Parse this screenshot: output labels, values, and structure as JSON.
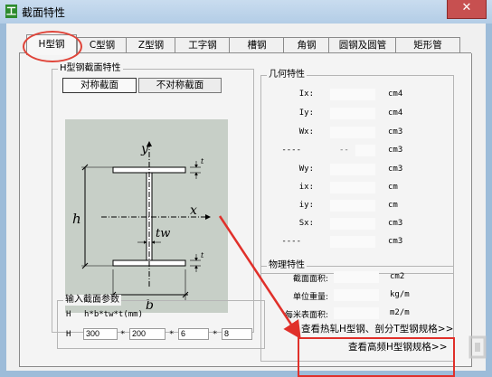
{
  "window": {
    "title": "截面特性",
    "close": "✕"
  },
  "tabs": [
    {
      "label": "H型钢"
    },
    {
      "label": "C型钢"
    },
    {
      "label": "Z型钢"
    },
    {
      "label": "工字钢"
    },
    {
      "label": "槽钢"
    },
    {
      "label": "角钢"
    },
    {
      "label": "圆钢及圆管"
    },
    {
      "label": "矩形管"
    }
  ],
  "section": {
    "group_title": "H型钢截面特性",
    "sym_button": "对称截面",
    "asym_button": "不对称截面"
  },
  "diagram": {
    "y": "y",
    "x": "x",
    "h": "h",
    "b": "b",
    "tw": "tw",
    "t": "t"
  },
  "geometry": {
    "title": "几何特性",
    "rows": [
      {
        "label": "Ix:",
        "unit": "cm4"
      },
      {
        "label": "Iy:",
        "unit": "cm4"
      },
      {
        "label": "Wx:",
        "unit": "cm3"
      },
      {
        "label": "----",
        "mid": "--",
        "unit": "cm3"
      },
      {
        "label": "Wy:",
        "unit": "cm3"
      },
      {
        "label": "ix:",
        "unit": "cm"
      },
      {
        "label": "iy:",
        "unit": "cm"
      },
      {
        "label": "Sx:",
        "unit": "cm3"
      },
      {
        "label": "----",
        "unit": "cm3"
      }
    ]
  },
  "physics": {
    "title": "物理特性",
    "rows": [
      {
        "label": "截面面积:",
        "unit": "cm2"
      },
      {
        "label": "单位重量:",
        "unit": "kg/m"
      },
      {
        "label": "每米表面积:",
        "unit": "m2/m"
      }
    ]
  },
  "input": {
    "title": "输入截面参数",
    "row1_label": "H",
    "formula": "h*b*tw*t(mm)",
    "row2_label": "H",
    "h": "300",
    "b": "200",
    "tw": "6",
    "t": "8",
    "star": "*"
  },
  "links": {
    "hot_rolled": "查看热轧H型钢、剖分T型钢规格>>",
    "high_freq": "查看高频H型钢规格>>"
  },
  "colors": {
    "highlight": "#e0302a",
    "figure_bg": "#c7cfc7"
  }
}
